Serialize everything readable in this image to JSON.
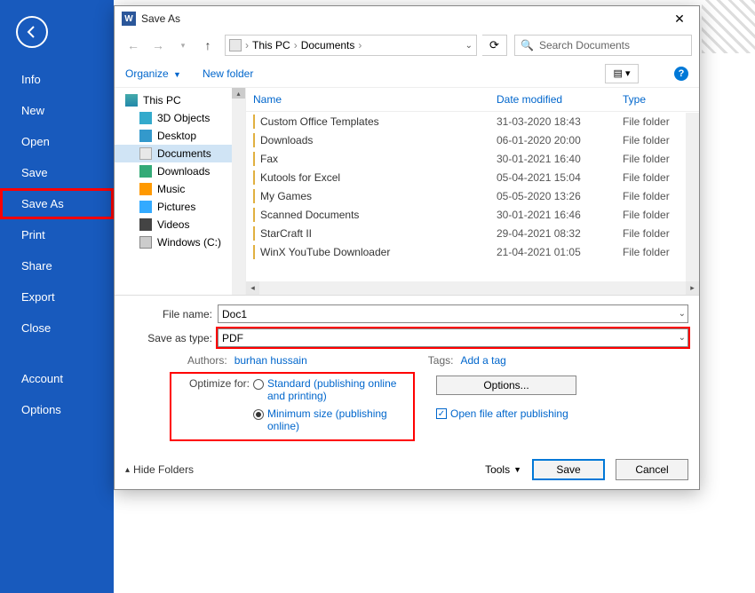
{
  "word_menu": {
    "items": [
      "Info",
      "New",
      "Open",
      "Save",
      "Save As",
      "Print",
      "Share",
      "Export",
      "Close"
    ],
    "account": "Account",
    "options": "Options",
    "highlighted_index": 4
  },
  "dialog": {
    "title": "Save As",
    "breadcrumb": {
      "root": "This PC",
      "folder": "Documents"
    },
    "search_placeholder": "Search Documents",
    "organize": "Organize",
    "new_folder": "New folder",
    "tree": {
      "root": "This PC",
      "children": [
        {
          "label": "3D Objects",
          "icon": "ic-cube"
        },
        {
          "label": "Desktop",
          "icon": "ic-desk"
        },
        {
          "label": "Documents",
          "icon": "ic-doc",
          "selected": true
        },
        {
          "label": "Downloads",
          "icon": "ic-dl"
        },
        {
          "label": "Music",
          "icon": "ic-music"
        },
        {
          "label": "Pictures",
          "icon": "ic-pic"
        },
        {
          "label": "Videos",
          "icon": "ic-vid"
        },
        {
          "label": "Windows (C:)",
          "icon": "ic-drive"
        }
      ]
    },
    "columns": {
      "name": "Name",
      "date": "Date modified",
      "type": "Type"
    },
    "rows": [
      {
        "name": "Custom Office Templates",
        "date": "31-03-2020 18:43",
        "type": "File folder"
      },
      {
        "name": "Downloads",
        "date": "06-01-2020 20:00",
        "type": "File folder"
      },
      {
        "name": "Fax",
        "date": "30-01-2021 16:40",
        "type": "File folder"
      },
      {
        "name": "Kutools for Excel",
        "date": "05-04-2021 15:04",
        "type": "File folder"
      },
      {
        "name": "My Games",
        "date": "05-05-2020 13:26",
        "type": "File folder"
      },
      {
        "name": "Scanned Documents",
        "date": "30-01-2021 16:46",
        "type": "File folder"
      },
      {
        "name": "StarCraft II",
        "date": "29-04-2021 08:32",
        "type": "File folder"
      },
      {
        "name": "WinX YouTube Downloader",
        "date": "21-04-2021 01:05",
        "type": "File folder"
      }
    ],
    "file_name_label": "File name:",
    "file_name_value": "Doc1",
    "save_type_label": "Save as type:",
    "save_type_value": "PDF",
    "authors_label": "Authors:",
    "authors_value": "burhan hussain",
    "tags_label": "Tags:",
    "tags_value": "Add a tag",
    "optimize_label": "Optimize for:",
    "optimize_standard": "Standard (publishing online and printing)",
    "optimize_minimum": "Minimum size (publishing online)",
    "options_button": "Options...",
    "open_after": "Open file after publishing",
    "hide_folders": "Hide Folders",
    "tools": "Tools",
    "save": "Save",
    "cancel": "Cancel"
  }
}
